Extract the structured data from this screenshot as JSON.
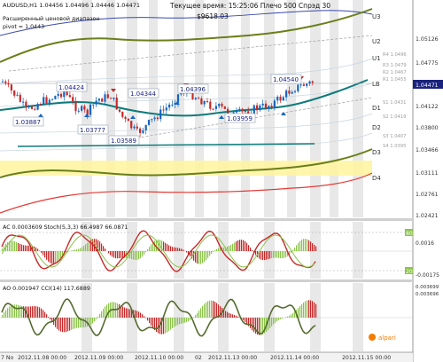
{
  "header": {
    "symbol_line": "AUDUSD,H1  1.04456 1.04496 1.04446 1.04471",
    "time_line": "Текущее время: 15:25:06 Плечо 500 Спрэд 30",
    "balance": "$9618.03",
    "indicator_name_1": "Расширенный ценовой диапазон",
    "indicator_name_2": "pivot = 1.0443"
  },
  "price_axis": {
    "labels": [
      "1.05126",
      "1.04775",
      "1.04471",
      "1.04122",
      "1.03800",
      "1.03466",
      "1.03111",
      "1.02761",
      "1.02421"
    ],
    "current": "1.04471",
    "current_color": "#1a237e"
  },
  "levels": {
    "right_labels": [
      "U3",
      "U2",
      "U1",
      "LB",
      "D1",
      "D2",
      "D3",
      "D4"
    ],
    "small_labels": [
      "R4 1.0496",
      "R3 1.0479",
      "R2 1.0467",
      "R1 1.0455",
      "S1 1.0431",
      "S2 1.0419",
      "S3 1.0407",
      "S4 1.0395"
    ]
  },
  "price_callouts": [
    "1.04424",
    "1.04344",
    "1.04396",
    "1.04540",
    "1.03887",
    "1.03777",
    "1.03589",
    "1.03959"
  ],
  "subwindows": {
    "ac_stoch_label": "AC 0.0003609  Stoch(5,3,3) 66.4987 66.0871",
    "ac_axis": [
      "80",
      "0.0016",
      "20",
      "-0.00175"
    ],
    "ao_cci_label": "AO 0.001947  CCI(14) 117.6889",
    "ao_axis": [
      "0.003699",
      "0.003696"
    ]
  },
  "time_axis": {
    "labels": [
      "7 No",
      "2012.11.08 00:00",
      "2012.11.09 00:00",
      "2012.11.10 00:00",
      "02",
      "2012.11.13 00:00",
      "2012.11.14 00:00",
      "2012.11.15 00:00"
    ]
  },
  "branding": {
    "logo_text": "alpari"
  },
  "colors": {
    "candle_up": "#1565c0",
    "candle_down": "#c62828",
    "olive": "#6b7f1a",
    "teal": "#0f7a7a",
    "band_yellow": "#fff59d",
    "red_line": "#e53935",
    "blue_line": "#3949ab"
  }
}
